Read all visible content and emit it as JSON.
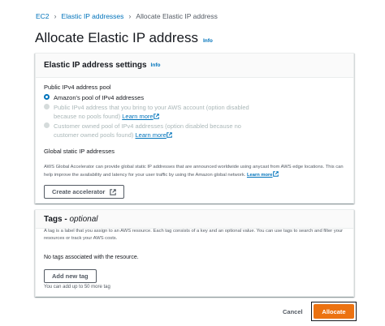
{
  "breadcrumb": {
    "items": [
      "EC2",
      "Elastic IP addresses"
    ],
    "current": "Allocate Elastic IP address"
  },
  "page": {
    "title": "Allocate Elastic IP address",
    "info": "Info"
  },
  "settings_panel": {
    "title": "Elastic IP address settings",
    "info": "Info",
    "pool_label": "Public IPv4 address pool",
    "options": [
      {
        "label": "Amazon's pool of IPv4 addresses",
        "selected": true,
        "disabled": false
      },
      {
        "label": "Public IPv4 address that you bring to your AWS account (option disabled because no pools found)",
        "link": "Learn more",
        "selected": false,
        "disabled": true
      },
      {
        "label": "Customer owned pool of IPv4 addresses (option disabled because no customer owned pools found)",
        "link": "Learn more",
        "selected": false,
        "disabled": true
      }
    ],
    "global_label": "Global static IP addresses",
    "global_desc": "AWS Global Accelerator can provide global static IP addresses that are announced worldwide using anycast from AWS edge locations. This can help improve the availability and latency for your user traffic by using the Amazon global network.",
    "global_link": "Learn more",
    "create_accelerator": "Create accelerator"
  },
  "tags_panel": {
    "title": "Tags -",
    "title_optional": "optional",
    "desc": "A tag is a label that you assign to an AWS resource. Each tag consists of a key and an optional value. You can use tags to search and filter your resources or track your AWS costs.",
    "empty": "No tags associated with the resource.",
    "add_button": "Add new tag",
    "limit": "You can add up to 50 more tag"
  },
  "footer": {
    "cancel": "Cancel",
    "allocate": "Allocate"
  },
  "colors": {
    "link": "#0073bb",
    "primary": "#ec7211"
  }
}
